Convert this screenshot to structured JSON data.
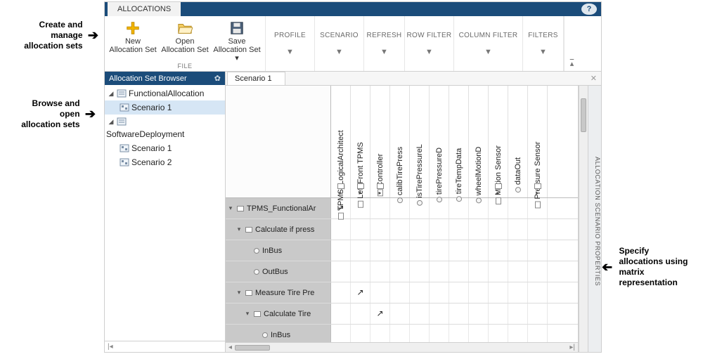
{
  "titlebar": {
    "tab": "ALLOCATIONS",
    "help": "?"
  },
  "ribbon": {
    "file_group_label": "FILE",
    "new_btn_l1": "New",
    "new_btn_l2": "Allocation Set",
    "open_btn_l1": "Open",
    "open_btn_l2": "Allocation Set",
    "save_btn_l1": "Save",
    "save_btn_l2": "Allocation Set ▾",
    "dd": {
      "profile": "PROFILE",
      "scenario": "SCENARIO",
      "refresh": "REFRESH",
      "rowfilter": "ROW FILTER",
      "colfilter": "COLUMN FILTER",
      "filters": "FILTERS"
    }
  },
  "browser": {
    "title": "Allocation Set Browser",
    "tree": {
      "func": "FunctionalAllocation",
      "func_s1": "Scenario 1",
      "soft": "SoftwareDeployment",
      "soft_s1": "Scenario 1",
      "soft_s2": "Scenario 2"
    }
  },
  "doc": {
    "tab": "Scenario 1"
  },
  "cols": [
    "TPMS_LogicalArchitect",
    "Left Front TPMS",
    "Controller",
    "calibTirePress",
    "isTirePressureL",
    "tirePressureD",
    "tireTempData",
    "wheelMotionD",
    "Motion Sensor",
    "dataOut",
    "Pressure Sensor"
  ],
  "col_kind": [
    "block",
    "block",
    "block",
    "port",
    "port",
    "port",
    "port",
    "port",
    "block",
    "port",
    "block"
  ],
  "col_expandable": [
    true,
    true,
    true,
    false,
    false,
    false,
    false,
    false,
    true,
    false,
    true
  ],
  "rowh": [
    {
      "label": "TPMS_FunctionalAr",
      "indent": 0,
      "kind": "block",
      "tw": true
    },
    {
      "label": "Calculate if press",
      "indent": 1,
      "kind": "block",
      "tw": true
    },
    {
      "label": "InBus",
      "indent": 2,
      "kind": "port",
      "tw": false
    },
    {
      "label": "OutBus",
      "indent": 2,
      "kind": "port",
      "tw": false
    },
    {
      "label": "Measure Tire Pre",
      "indent": 1,
      "kind": "block",
      "tw": true
    },
    {
      "label": "Calculate Tire",
      "indent": 2,
      "kind": "block",
      "tw": true
    },
    {
      "label": "InBus",
      "indent": 3,
      "kind": "port",
      "tw": false
    }
  ],
  "marks": [
    {
      "row": 0,
      "col": 0
    },
    {
      "row": 4,
      "col": 1
    },
    {
      "row": 5,
      "col": 2
    }
  ],
  "props_label": "ALLOCATION SCENARIO PROPERTIES",
  "annotations": {
    "create": "Create and\nmanage\nallocation sets",
    "browse": "Browse and\nopen\nallocation sets",
    "specify": "Specify\nallocations using\nmatrix\nrepresentation"
  }
}
